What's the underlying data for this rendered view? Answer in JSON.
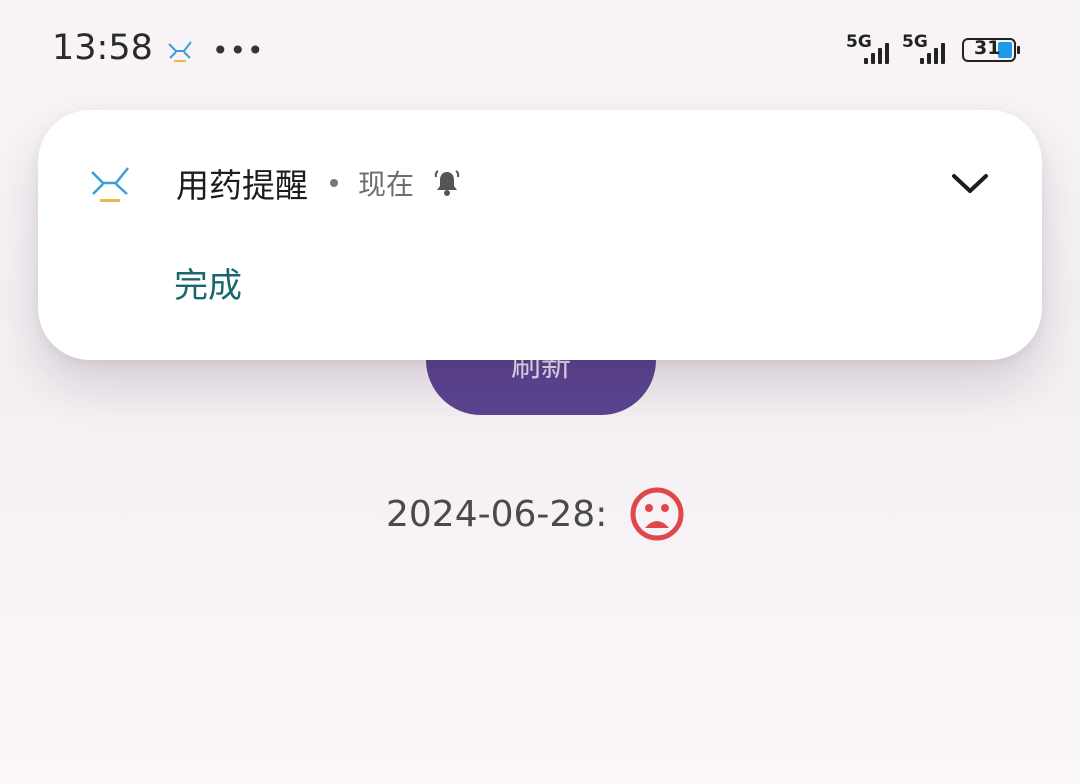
{
  "status_bar": {
    "time": "13:58",
    "more": "•••",
    "network1": "5G",
    "network2": "5G",
    "battery": "31",
    "battery_color": "#1e9be8"
  },
  "notification": {
    "app_name": "用药提醒",
    "time": "现在",
    "action": "完成",
    "action_color": "#16676e"
  },
  "page": {
    "refresh_label": "刷新",
    "date": "2024-06-28:",
    "mood_icon": "sad-face-icon",
    "accent": "#5b4491"
  }
}
